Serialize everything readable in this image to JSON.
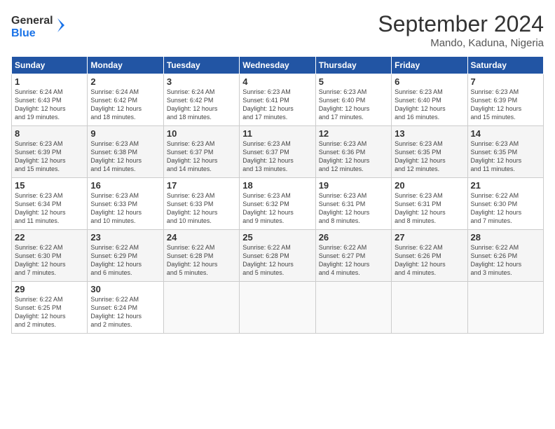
{
  "header": {
    "logo_line1": "General",
    "logo_line2": "Blue",
    "month_title": "September 2024",
    "location": "Mando, Kaduna, Nigeria"
  },
  "columns": [
    "Sunday",
    "Monday",
    "Tuesday",
    "Wednesday",
    "Thursday",
    "Friday",
    "Saturday"
  ],
  "weeks": [
    [
      {
        "day": "1",
        "text": "Sunrise: 6:24 AM\nSunset: 6:43 PM\nDaylight: 12 hours\nand 19 minutes."
      },
      {
        "day": "2",
        "text": "Sunrise: 6:24 AM\nSunset: 6:42 PM\nDaylight: 12 hours\nand 18 minutes."
      },
      {
        "day": "3",
        "text": "Sunrise: 6:24 AM\nSunset: 6:42 PM\nDaylight: 12 hours\nand 18 minutes."
      },
      {
        "day": "4",
        "text": "Sunrise: 6:23 AM\nSunset: 6:41 PM\nDaylight: 12 hours\nand 17 minutes."
      },
      {
        "day": "5",
        "text": "Sunrise: 6:23 AM\nSunset: 6:40 PM\nDaylight: 12 hours\nand 17 minutes."
      },
      {
        "day": "6",
        "text": "Sunrise: 6:23 AM\nSunset: 6:40 PM\nDaylight: 12 hours\nand 16 minutes."
      },
      {
        "day": "7",
        "text": "Sunrise: 6:23 AM\nSunset: 6:39 PM\nDaylight: 12 hours\nand 15 minutes."
      }
    ],
    [
      {
        "day": "8",
        "text": "Sunrise: 6:23 AM\nSunset: 6:39 PM\nDaylight: 12 hours\nand 15 minutes."
      },
      {
        "day": "9",
        "text": "Sunrise: 6:23 AM\nSunset: 6:38 PM\nDaylight: 12 hours\nand 14 minutes."
      },
      {
        "day": "10",
        "text": "Sunrise: 6:23 AM\nSunset: 6:37 PM\nDaylight: 12 hours\nand 14 minutes."
      },
      {
        "day": "11",
        "text": "Sunrise: 6:23 AM\nSunset: 6:37 PM\nDaylight: 12 hours\nand 13 minutes."
      },
      {
        "day": "12",
        "text": "Sunrise: 6:23 AM\nSunset: 6:36 PM\nDaylight: 12 hours\nand 12 minutes."
      },
      {
        "day": "13",
        "text": "Sunrise: 6:23 AM\nSunset: 6:35 PM\nDaylight: 12 hours\nand 12 minutes."
      },
      {
        "day": "14",
        "text": "Sunrise: 6:23 AM\nSunset: 6:35 PM\nDaylight: 12 hours\nand 11 minutes."
      }
    ],
    [
      {
        "day": "15",
        "text": "Sunrise: 6:23 AM\nSunset: 6:34 PM\nDaylight: 12 hours\nand 11 minutes."
      },
      {
        "day": "16",
        "text": "Sunrise: 6:23 AM\nSunset: 6:33 PM\nDaylight: 12 hours\nand 10 minutes."
      },
      {
        "day": "17",
        "text": "Sunrise: 6:23 AM\nSunset: 6:33 PM\nDaylight: 12 hours\nand 10 minutes."
      },
      {
        "day": "18",
        "text": "Sunrise: 6:23 AM\nSunset: 6:32 PM\nDaylight: 12 hours\nand 9 minutes."
      },
      {
        "day": "19",
        "text": "Sunrise: 6:23 AM\nSunset: 6:31 PM\nDaylight: 12 hours\nand 8 minutes."
      },
      {
        "day": "20",
        "text": "Sunrise: 6:23 AM\nSunset: 6:31 PM\nDaylight: 12 hours\nand 8 minutes."
      },
      {
        "day": "21",
        "text": "Sunrise: 6:22 AM\nSunset: 6:30 PM\nDaylight: 12 hours\nand 7 minutes."
      }
    ],
    [
      {
        "day": "22",
        "text": "Sunrise: 6:22 AM\nSunset: 6:30 PM\nDaylight: 12 hours\nand 7 minutes."
      },
      {
        "day": "23",
        "text": "Sunrise: 6:22 AM\nSunset: 6:29 PM\nDaylight: 12 hours\nand 6 minutes."
      },
      {
        "day": "24",
        "text": "Sunrise: 6:22 AM\nSunset: 6:28 PM\nDaylight: 12 hours\nand 5 minutes."
      },
      {
        "day": "25",
        "text": "Sunrise: 6:22 AM\nSunset: 6:28 PM\nDaylight: 12 hours\nand 5 minutes."
      },
      {
        "day": "26",
        "text": "Sunrise: 6:22 AM\nSunset: 6:27 PM\nDaylight: 12 hours\nand 4 minutes."
      },
      {
        "day": "27",
        "text": "Sunrise: 6:22 AM\nSunset: 6:26 PM\nDaylight: 12 hours\nand 4 minutes."
      },
      {
        "day": "28",
        "text": "Sunrise: 6:22 AM\nSunset: 6:26 PM\nDaylight: 12 hours\nand 3 minutes."
      }
    ],
    [
      {
        "day": "29",
        "text": "Sunrise: 6:22 AM\nSunset: 6:25 PM\nDaylight: 12 hours\nand 2 minutes."
      },
      {
        "day": "30",
        "text": "Sunrise: 6:22 AM\nSunset: 6:24 PM\nDaylight: 12 hours\nand 2 minutes."
      },
      {
        "day": "",
        "text": ""
      },
      {
        "day": "",
        "text": ""
      },
      {
        "day": "",
        "text": ""
      },
      {
        "day": "",
        "text": ""
      },
      {
        "day": "",
        "text": ""
      }
    ]
  ]
}
